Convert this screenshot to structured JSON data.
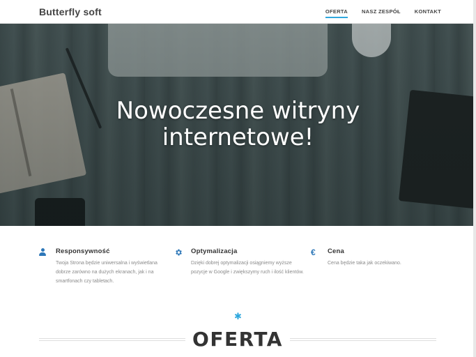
{
  "navbar": {
    "brand": "Butterfly soft",
    "links": [
      {
        "label": "OFERTA",
        "active": true
      },
      {
        "label": "NASZ ZESPÓŁ",
        "active": false
      },
      {
        "label": "KONTAKT",
        "active": false
      }
    ]
  },
  "hero": {
    "title_line1": "Nowoczesne witryny",
    "title_line2": "internetowe!"
  },
  "features": [
    {
      "icon": "user-icon",
      "title": "Responsywność",
      "text": "Twoja Strona będzie uniwersalna i wyświetlana dobrze zarówno na dużych ekranach, jak i na smartfonach czy tabletach."
    },
    {
      "icon": "gear-icon",
      "title": "Optymalizacja",
      "text": "Dzięki dobrej optymalizacji osiągniemy wyższe pozycje w Google i zwiększymy ruch i ilość klientów."
    },
    {
      "icon": "euro-icon",
      "title": "Cena",
      "text": "Cena będzie taka jak oczekiwano."
    }
  ],
  "section": {
    "star": "✱",
    "title": "OFERTA"
  },
  "colors": {
    "accent": "#2fa8de",
    "icon_blue": "#2d77b8"
  }
}
